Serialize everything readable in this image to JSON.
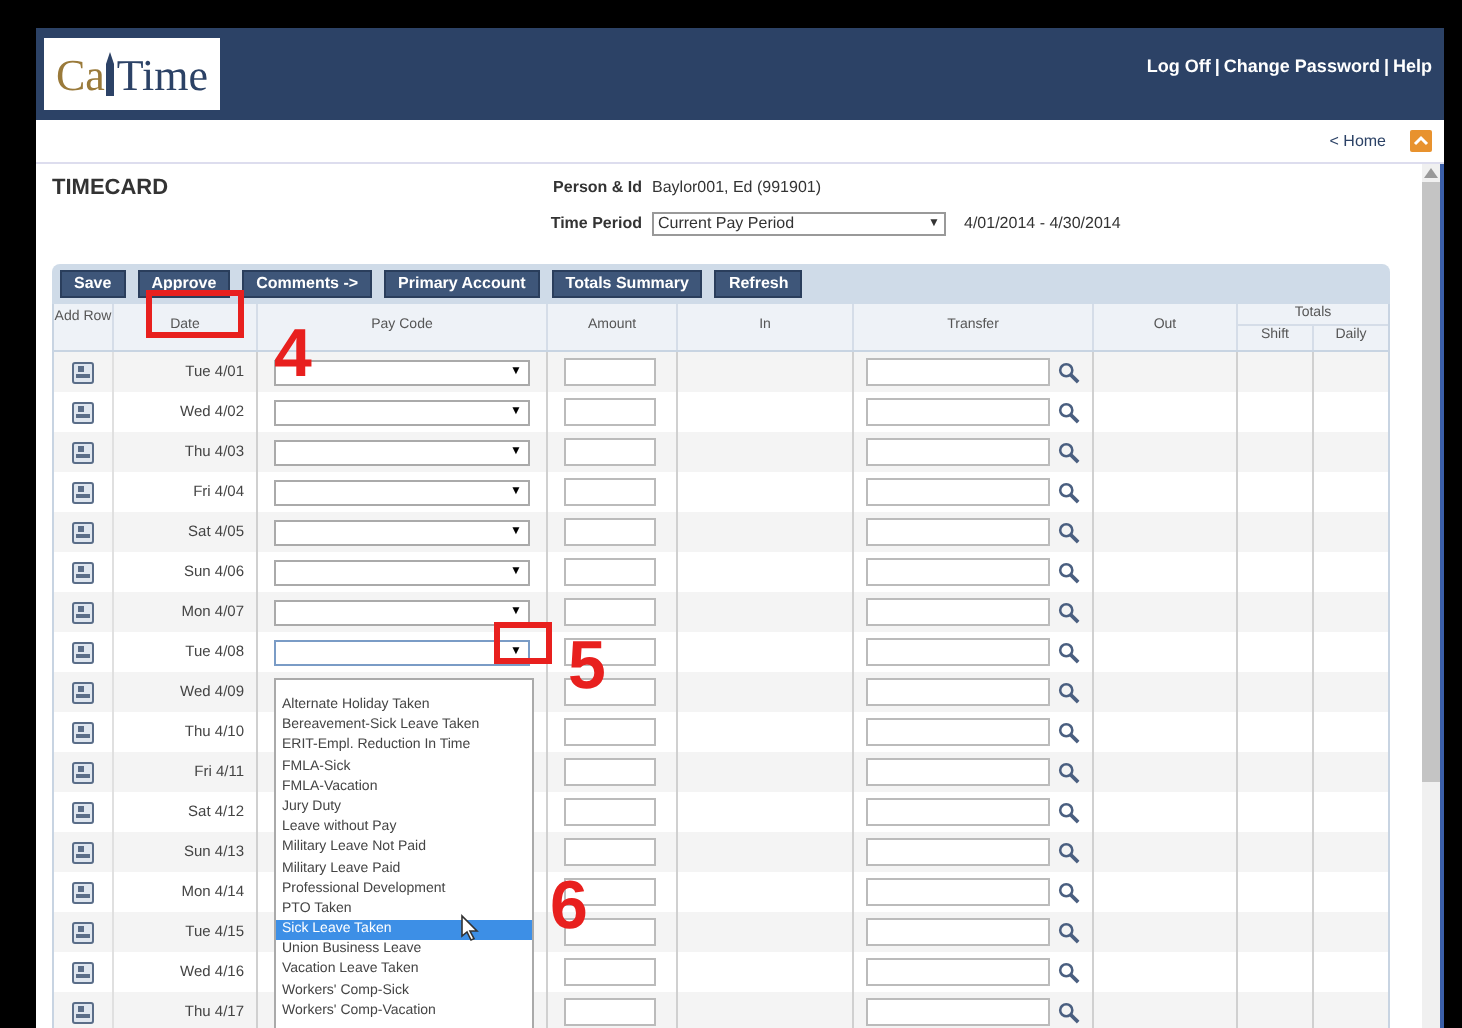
{
  "header": {
    "logo": {
      "part_1": "Ca",
      "part_2": "Time"
    },
    "links": [
      "Log Off",
      "Change Password",
      "Help"
    ],
    "separator": "|"
  },
  "nav": {
    "home_link": "< Home"
  },
  "title": "TIMECARD",
  "person": {
    "label": "Person & Id",
    "value": "Baylor001, Ed (991901)"
  },
  "time_period": {
    "label": "Time Period",
    "value": "Current Pay Period",
    "arrow": "▼",
    "range": "4/01/2014 - 4/30/2014"
  },
  "toolbar": [
    "Save",
    "Approve",
    "Comments ->",
    "Primary Account",
    "Totals Summary",
    "Refresh"
  ],
  "table": {
    "columns": {
      "add_row": "Add Row",
      "date": "Date",
      "pay_code": "Pay Code",
      "amount": "Amount",
      "in": "In",
      "transfer": "Transfer",
      "out": "Out",
      "totals": "Totals",
      "shift": "Shift",
      "daily": "Daily"
    },
    "rows": [
      {
        "date": "Tue 4/01"
      },
      {
        "date": "Wed 4/02"
      },
      {
        "date": "Thu 4/03"
      },
      {
        "date": "Fri 4/04"
      },
      {
        "date": "Sat 4/05"
      },
      {
        "date": "Sun 4/06"
      },
      {
        "date": "Mon 4/07"
      },
      {
        "date": "Tue 4/08",
        "pay_code_options": [
          {
            "label": "Alternate Holiday Taken",
            "selected": false
          },
          {
            "label": "Bereavement-Sick Leave Taken",
            "selected": false
          },
          {
            "label": "ERIT-Empl. Reduction In Time",
            "selected": false
          },
          {
            "label": "FMLA-Sick",
            "selected": false
          },
          {
            "label": "FMLA-Vacation",
            "selected": false
          },
          {
            "label": "Jury Duty",
            "selected": false
          },
          {
            "label": "Leave without Pay",
            "selected": false
          },
          {
            "label": "Military Leave Not Paid",
            "selected": false
          },
          {
            "label": "Military Leave Paid",
            "selected": false
          },
          {
            "label": "Professional Development",
            "selected": false
          },
          {
            "label": "PTO Taken",
            "selected": false
          },
          {
            "label": "Sick Leave Taken",
            "selected": true
          },
          {
            "label": "Union Business Leave",
            "selected": false
          },
          {
            "label": "Vacation Leave Taken",
            "selected": false
          },
          {
            "label": "Workers' Comp-Sick",
            "selected": false
          },
          {
            "label": "Workers' Comp-Vacation",
            "selected": false
          }
        ]
      },
      {
        "date": "Wed 4/09"
      },
      {
        "date": "Thu 4/10"
      },
      {
        "date": "Fri 4/11"
      },
      {
        "date": "Sat 4/12"
      },
      {
        "date": "Sun 4/13"
      },
      {
        "date": "Mon 4/14"
      },
      {
        "date": "Tue 4/15"
      },
      {
        "date": "Wed 4/16"
      },
      {
        "date": "Thu 4/17"
      }
    ],
    "select_arrow": "▼"
  },
  "annotations": [
    {
      "label": "4"
    },
    {
      "label": "5"
    },
    {
      "label": "6"
    }
  ]
}
